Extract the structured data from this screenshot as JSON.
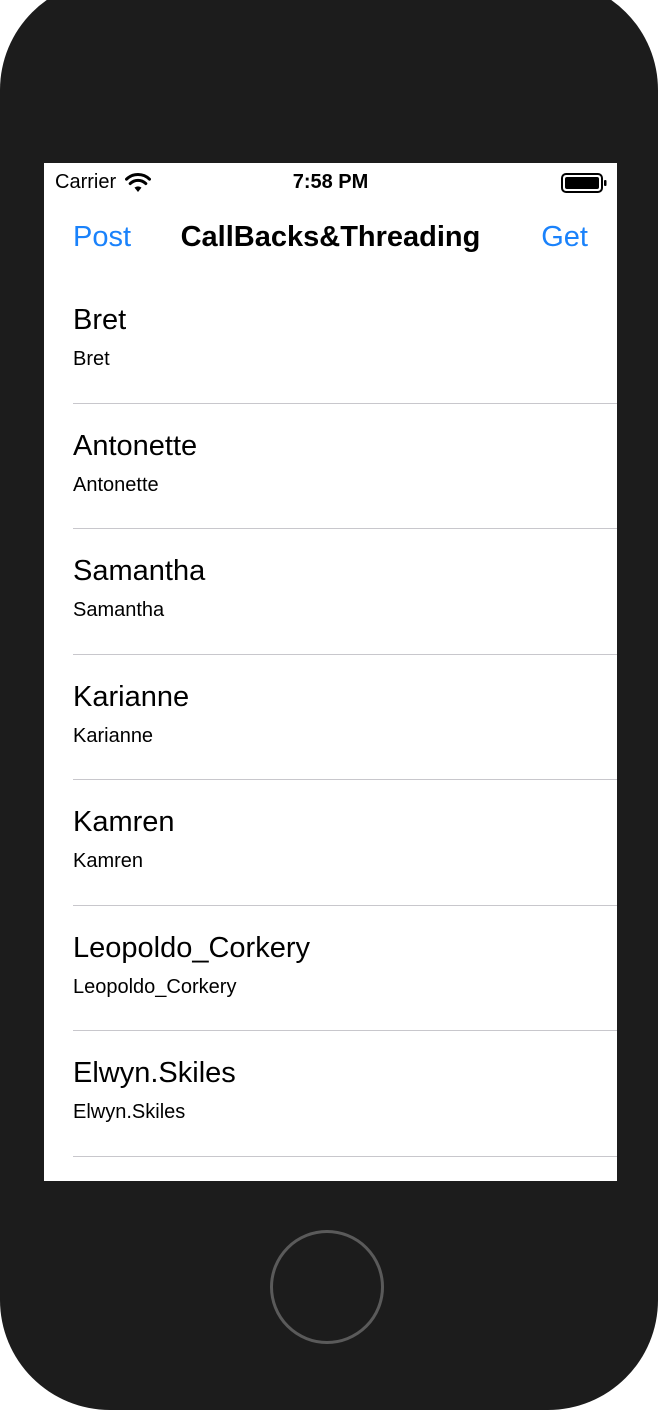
{
  "status_bar": {
    "carrier": "Carrier",
    "time": "7:58 PM"
  },
  "nav": {
    "left_button": "Post",
    "title": "CallBacks&Threading",
    "right_button": "Get"
  },
  "rows": [
    {
      "title": "Bret",
      "subtitle": "Bret"
    },
    {
      "title": "Antonette",
      "subtitle": "Antonette"
    },
    {
      "title": "Samantha",
      "subtitle": "Samantha"
    },
    {
      "title": "Karianne",
      "subtitle": "Karianne"
    },
    {
      "title": "Kamren",
      "subtitle": "Kamren"
    },
    {
      "title": "Leopoldo_Corkery",
      "subtitle": "Leopoldo_Corkery"
    },
    {
      "title": "Elwyn.Skiles",
      "subtitle": "Elwyn.Skiles"
    }
  ],
  "colors": {
    "tint": "#1a82fb",
    "device": "#1c1c1c",
    "separator": "#c8c7cc"
  }
}
